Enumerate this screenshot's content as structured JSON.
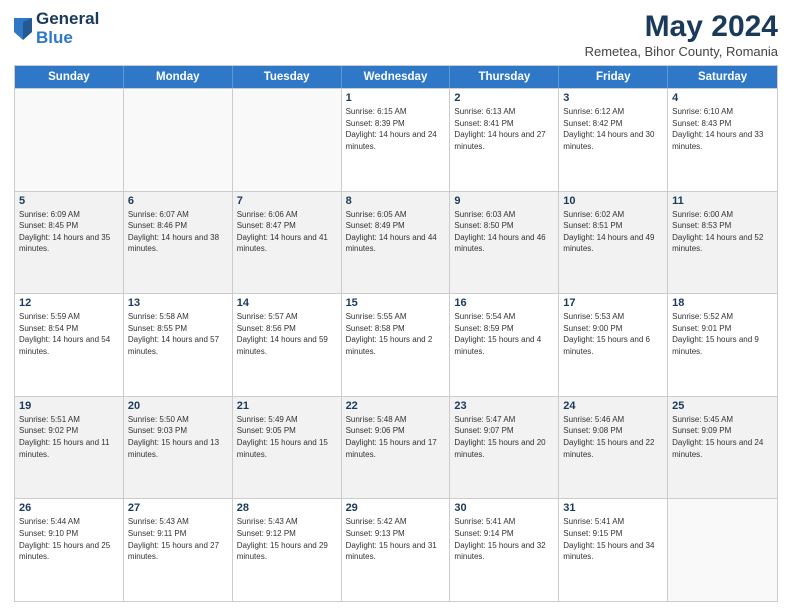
{
  "logo": {
    "general": "General",
    "blue": "Blue"
  },
  "title": {
    "month_year": "May 2024",
    "location": "Remetea, Bihor County, Romania"
  },
  "weekdays": [
    "Sunday",
    "Monday",
    "Tuesday",
    "Wednesday",
    "Thursday",
    "Friday",
    "Saturday"
  ],
  "rows": [
    [
      {
        "day": "",
        "sunrise": "",
        "sunset": "",
        "daylight": "",
        "empty": true
      },
      {
        "day": "",
        "sunrise": "",
        "sunset": "",
        "daylight": "",
        "empty": true
      },
      {
        "day": "",
        "sunrise": "",
        "sunset": "",
        "daylight": "",
        "empty": true
      },
      {
        "day": "1",
        "sunrise": "Sunrise: 6:15 AM",
        "sunset": "Sunset: 8:39 PM",
        "daylight": "Daylight: 14 hours and 24 minutes."
      },
      {
        "day": "2",
        "sunrise": "Sunrise: 6:13 AM",
        "sunset": "Sunset: 8:41 PM",
        "daylight": "Daylight: 14 hours and 27 minutes."
      },
      {
        "day": "3",
        "sunrise": "Sunrise: 6:12 AM",
        "sunset": "Sunset: 8:42 PM",
        "daylight": "Daylight: 14 hours and 30 minutes."
      },
      {
        "day": "4",
        "sunrise": "Sunrise: 6:10 AM",
        "sunset": "Sunset: 8:43 PM",
        "daylight": "Daylight: 14 hours and 33 minutes."
      }
    ],
    [
      {
        "day": "5",
        "sunrise": "Sunrise: 6:09 AM",
        "sunset": "Sunset: 8:45 PM",
        "daylight": "Daylight: 14 hours and 35 minutes."
      },
      {
        "day": "6",
        "sunrise": "Sunrise: 6:07 AM",
        "sunset": "Sunset: 8:46 PM",
        "daylight": "Daylight: 14 hours and 38 minutes."
      },
      {
        "day": "7",
        "sunrise": "Sunrise: 6:06 AM",
        "sunset": "Sunset: 8:47 PM",
        "daylight": "Daylight: 14 hours and 41 minutes."
      },
      {
        "day": "8",
        "sunrise": "Sunrise: 6:05 AM",
        "sunset": "Sunset: 8:49 PM",
        "daylight": "Daylight: 14 hours and 44 minutes."
      },
      {
        "day": "9",
        "sunrise": "Sunrise: 6:03 AM",
        "sunset": "Sunset: 8:50 PM",
        "daylight": "Daylight: 14 hours and 46 minutes."
      },
      {
        "day": "10",
        "sunrise": "Sunrise: 6:02 AM",
        "sunset": "Sunset: 8:51 PM",
        "daylight": "Daylight: 14 hours and 49 minutes."
      },
      {
        "day": "11",
        "sunrise": "Sunrise: 6:00 AM",
        "sunset": "Sunset: 8:53 PM",
        "daylight": "Daylight: 14 hours and 52 minutes."
      }
    ],
    [
      {
        "day": "12",
        "sunrise": "Sunrise: 5:59 AM",
        "sunset": "Sunset: 8:54 PM",
        "daylight": "Daylight: 14 hours and 54 minutes."
      },
      {
        "day": "13",
        "sunrise": "Sunrise: 5:58 AM",
        "sunset": "Sunset: 8:55 PM",
        "daylight": "Daylight: 14 hours and 57 minutes."
      },
      {
        "day": "14",
        "sunrise": "Sunrise: 5:57 AM",
        "sunset": "Sunset: 8:56 PM",
        "daylight": "Daylight: 14 hours and 59 minutes."
      },
      {
        "day": "15",
        "sunrise": "Sunrise: 5:55 AM",
        "sunset": "Sunset: 8:58 PM",
        "daylight": "Daylight: 15 hours and 2 minutes."
      },
      {
        "day": "16",
        "sunrise": "Sunrise: 5:54 AM",
        "sunset": "Sunset: 8:59 PM",
        "daylight": "Daylight: 15 hours and 4 minutes."
      },
      {
        "day": "17",
        "sunrise": "Sunrise: 5:53 AM",
        "sunset": "Sunset: 9:00 PM",
        "daylight": "Daylight: 15 hours and 6 minutes."
      },
      {
        "day": "18",
        "sunrise": "Sunrise: 5:52 AM",
        "sunset": "Sunset: 9:01 PM",
        "daylight": "Daylight: 15 hours and 9 minutes."
      }
    ],
    [
      {
        "day": "19",
        "sunrise": "Sunrise: 5:51 AM",
        "sunset": "Sunset: 9:02 PM",
        "daylight": "Daylight: 15 hours and 11 minutes."
      },
      {
        "day": "20",
        "sunrise": "Sunrise: 5:50 AM",
        "sunset": "Sunset: 9:03 PM",
        "daylight": "Daylight: 15 hours and 13 minutes."
      },
      {
        "day": "21",
        "sunrise": "Sunrise: 5:49 AM",
        "sunset": "Sunset: 9:05 PM",
        "daylight": "Daylight: 15 hours and 15 minutes."
      },
      {
        "day": "22",
        "sunrise": "Sunrise: 5:48 AM",
        "sunset": "Sunset: 9:06 PM",
        "daylight": "Daylight: 15 hours and 17 minutes."
      },
      {
        "day": "23",
        "sunrise": "Sunrise: 5:47 AM",
        "sunset": "Sunset: 9:07 PM",
        "daylight": "Daylight: 15 hours and 20 minutes."
      },
      {
        "day": "24",
        "sunrise": "Sunrise: 5:46 AM",
        "sunset": "Sunset: 9:08 PM",
        "daylight": "Daylight: 15 hours and 22 minutes."
      },
      {
        "day": "25",
        "sunrise": "Sunrise: 5:45 AM",
        "sunset": "Sunset: 9:09 PM",
        "daylight": "Daylight: 15 hours and 24 minutes."
      }
    ],
    [
      {
        "day": "26",
        "sunrise": "Sunrise: 5:44 AM",
        "sunset": "Sunset: 9:10 PM",
        "daylight": "Daylight: 15 hours and 25 minutes."
      },
      {
        "day": "27",
        "sunrise": "Sunrise: 5:43 AM",
        "sunset": "Sunset: 9:11 PM",
        "daylight": "Daylight: 15 hours and 27 minutes."
      },
      {
        "day": "28",
        "sunrise": "Sunrise: 5:43 AM",
        "sunset": "Sunset: 9:12 PM",
        "daylight": "Daylight: 15 hours and 29 minutes."
      },
      {
        "day": "29",
        "sunrise": "Sunrise: 5:42 AM",
        "sunset": "Sunset: 9:13 PM",
        "daylight": "Daylight: 15 hours and 31 minutes."
      },
      {
        "day": "30",
        "sunrise": "Sunrise: 5:41 AM",
        "sunset": "Sunset: 9:14 PM",
        "daylight": "Daylight: 15 hours and 32 minutes."
      },
      {
        "day": "31",
        "sunrise": "Sunrise: 5:41 AM",
        "sunset": "Sunset: 9:15 PM",
        "daylight": "Daylight: 15 hours and 34 minutes."
      },
      {
        "day": "",
        "sunrise": "",
        "sunset": "",
        "daylight": "",
        "empty": true
      }
    ]
  ]
}
